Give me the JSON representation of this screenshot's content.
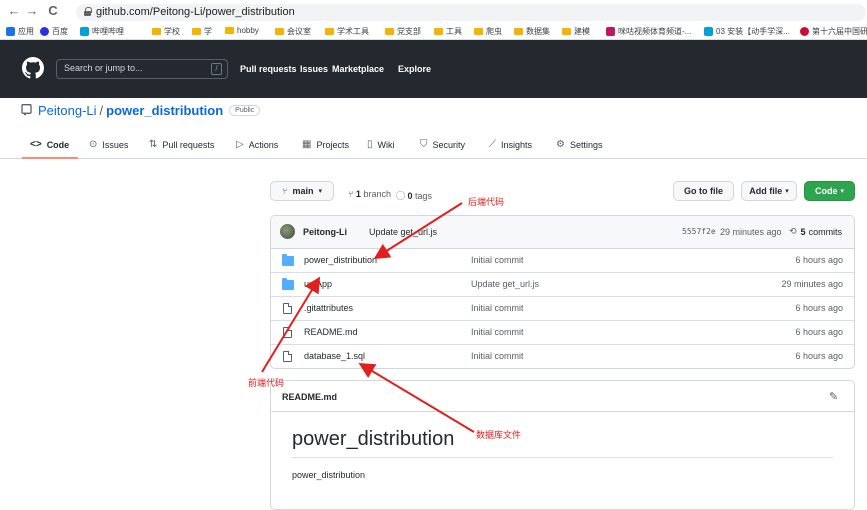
{
  "browser": {
    "back_icon": "←",
    "forward_icon": "→",
    "reload_icon": "C",
    "url": "github.com/Peitong-Li/power_distribution",
    "bookmarks": [
      {
        "label": "应用",
        "icon": "apps-icon",
        "color": "#1a73e8"
      },
      {
        "label": "百度",
        "icon": "baidu-icon",
        "color": "#2932e1"
      },
      {
        "label": "哔哩哔哩",
        "icon": "bilibili-icon",
        "color": "#00a1d6"
      },
      {
        "label": "学校",
        "icon": "folder-icon",
        "color": "#f4b400"
      },
      {
        "label": "学",
        "icon": "folder-icon",
        "color": "#f4b400"
      },
      {
        "label": "hobby",
        "icon": "folder-icon",
        "color": "#f4b400"
      },
      {
        "label": "会议室",
        "icon": "folder-icon",
        "color": "#f4b400"
      },
      {
        "label": "学术工具",
        "icon": "folder-icon",
        "color": "#f4b400"
      },
      {
        "label": "党支部",
        "icon": "folder-icon",
        "color": "#f4b400"
      },
      {
        "label": "工具",
        "icon": "folder-icon",
        "color": "#f4b400"
      },
      {
        "label": "爬虫",
        "icon": "folder-icon",
        "color": "#f4b400"
      },
      {
        "label": "数据集",
        "icon": "folder-icon",
        "color": "#f4b400"
      },
      {
        "label": "建模",
        "icon": "folder-icon",
        "color": "#f4b400"
      },
      {
        "label": "咪咕视频体育频道-...",
        "icon": "migu-icon",
        "color": "#c2185b"
      },
      {
        "label": "03 安装【动手学深...",
        "icon": "bilibili-icon",
        "color": "#00a1d6"
      },
      {
        "label": "第十六届中国研",
        "icon": "huawei-icon",
        "color": "#cf0a2c"
      }
    ]
  },
  "header": {
    "search_placeholder": "Search or jump to...",
    "search_shortcut": "/",
    "nav": [
      "Pull requests",
      "Issues",
      "Marketplace",
      "Explore"
    ]
  },
  "repo": {
    "owner": "Peitong-Li",
    "separator": "/",
    "name": "power_distribution",
    "visibility": "Public"
  },
  "tabs": [
    {
      "label": "Code",
      "icon": "<>"
    },
    {
      "label": "Issues",
      "icon": "⊙"
    },
    {
      "label": "Pull requests",
      "icon": "⇅"
    },
    {
      "label": "Actions",
      "icon": "▷"
    },
    {
      "label": "Projects",
      "icon": "▦"
    },
    {
      "label": "Wiki",
      "icon": "▯"
    },
    {
      "label": "Security",
      "icon": "⛉"
    },
    {
      "label": "Insights",
      "icon": "⟋"
    },
    {
      "label": "Settings",
      "icon": "⚙"
    }
  ],
  "branch": {
    "current": "main",
    "branches_count": "1",
    "branches_label": "branch",
    "tags_count": "0",
    "tags_label": "tags",
    "go_to_file": "Go to file",
    "add_file": "Add file",
    "code": "Code"
  },
  "commit": {
    "author": "Peitong-Li",
    "message": "Update get_url.js",
    "hash": "5557f2e",
    "time": "29 minutes ago",
    "count": "5",
    "count_label": "commits"
  },
  "files": [
    {
      "name": "power_distribution",
      "type": "dir",
      "message": "Initial commit",
      "time": "6 hours ago"
    },
    {
      "name": "uniApp",
      "type": "dir",
      "message": "Update get_url.js",
      "time": "29 minutes ago"
    },
    {
      "name": ".gitattributes",
      "type": "file",
      "message": "Initial commit",
      "time": "6 hours ago"
    },
    {
      "name": "README.md",
      "type": "file",
      "message": "Initial commit",
      "time": "6 hours ago"
    },
    {
      "name": "database_1.sql",
      "type": "file",
      "message": "Initial commit",
      "time": "6 hours ago"
    }
  ],
  "readme": {
    "label": "README.md",
    "heading": "power_distribution",
    "body": "power_distribution"
  },
  "annotations": {
    "backend": "后端代码",
    "frontend": "前端代码",
    "database": "数据库文件",
    "color": "#e0201c"
  }
}
